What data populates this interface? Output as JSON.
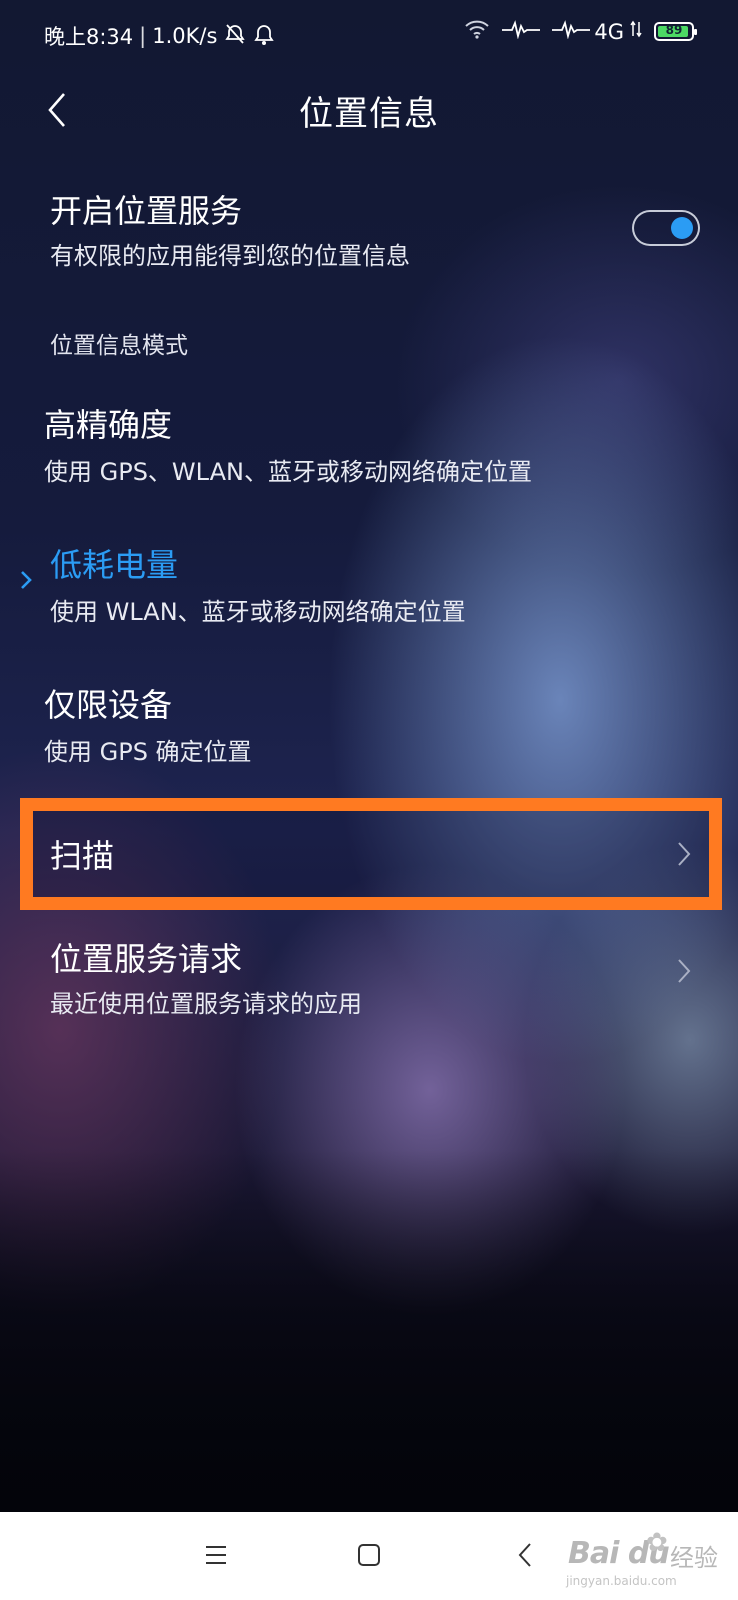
{
  "status_bar": {
    "time": "晚上8:34",
    "separator": "|",
    "net_speed": "1.0K/s",
    "network": "4G",
    "battery_level": "89",
    "icons": [
      "alarm-off-icon",
      "bell-icon",
      "wifi-icon",
      "signal-icon",
      "signal-icon",
      "data-arrows-icon",
      "battery-icon"
    ]
  },
  "header": {
    "title": "位置信息"
  },
  "location_service": {
    "title": "开启位置服务",
    "subtitle": "有权限的应用能得到您的位置信息",
    "enabled": true
  },
  "mode_section": {
    "label": "位置信息模式",
    "selected_index": 1,
    "options": [
      {
        "title": "高精确度",
        "subtitle": "使用 GPS、WLAN、蓝牙或移动网络确定位置"
      },
      {
        "title": "低耗电量",
        "subtitle": "使用 WLAN、蓝牙或移动网络确定位置"
      },
      {
        "title": "仅限设备",
        "subtitle": "使用 GPS 确定位置"
      }
    ]
  },
  "scan": {
    "title": "扫描"
  },
  "service_requests": {
    "title": "位置服务请求",
    "subtitle": "最近使用位置服务请求的应用"
  },
  "watermark": {
    "logo": "Bai du",
    "jingyan": "经验",
    "url": "jingyan.baidu.com"
  },
  "colors": {
    "accent": "#2b9cf4",
    "highlight_box": "#ff7a21",
    "battery_fill": "#4cd964"
  }
}
